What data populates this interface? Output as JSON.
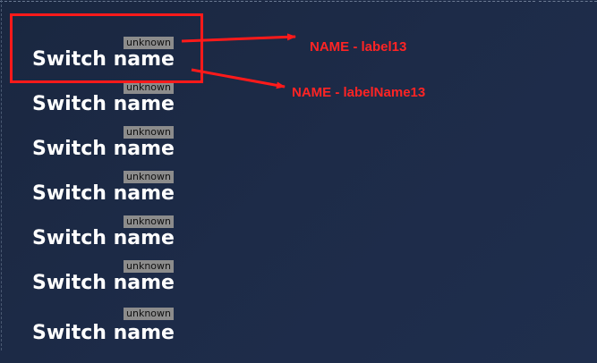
{
  "switches": [
    {
      "status": "unknown",
      "name": "Switch name"
    },
    {
      "status": "unknown",
      "name": "Switch name"
    },
    {
      "status": "unknown",
      "name": "Switch name"
    },
    {
      "status": "unknown",
      "name": "Switch name"
    },
    {
      "status": "unknown",
      "name": "Switch name"
    },
    {
      "status": "unknown",
      "name": "Switch name"
    },
    {
      "status": "unknown",
      "name": "Switch name"
    }
  ],
  "annotations": {
    "label_callout": "NAME - label13",
    "name_callout": "NAME - labelName13",
    "color": "#ff1a1a"
  },
  "colors": {
    "background": "#1d2b48",
    "status_tag_background": "#8c8c8c",
    "switch_name_text": "#ffffff"
  }
}
